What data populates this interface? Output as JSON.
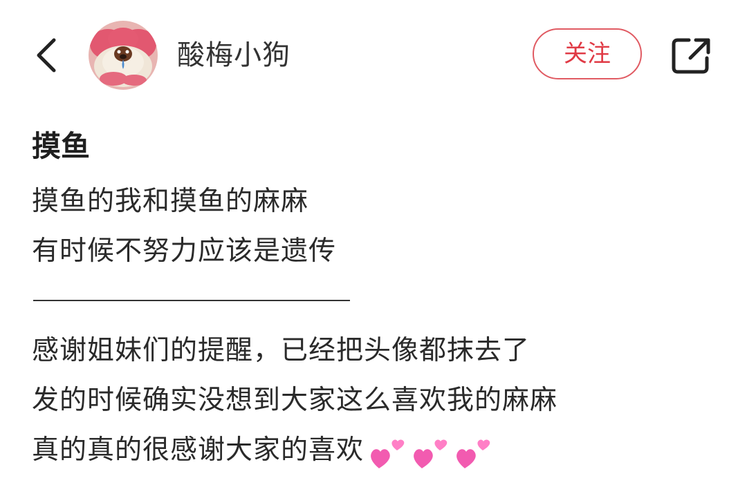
{
  "header": {
    "username": "酸梅小狗",
    "follow_label": "关注"
  },
  "post": {
    "title": "摸鱼",
    "lines": [
      "摸鱼的我和摸鱼的麻麻",
      "有时候不努力应该是遗传",
      "",
      "感谢姐妹们的提醒，已经把头像都抹去了",
      "发的时候确实没想到大家这么喜欢我的麻麻",
      "真的真的很感谢大家的喜欢"
    ],
    "emoji": "💕💕💕"
  },
  "icons": {
    "back": "chevron-left-icon",
    "share": "share-icon",
    "heart": "two-hearts-emoji"
  },
  "colors": {
    "accent": "#e03a45",
    "heart": "#ff4fa8"
  }
}
